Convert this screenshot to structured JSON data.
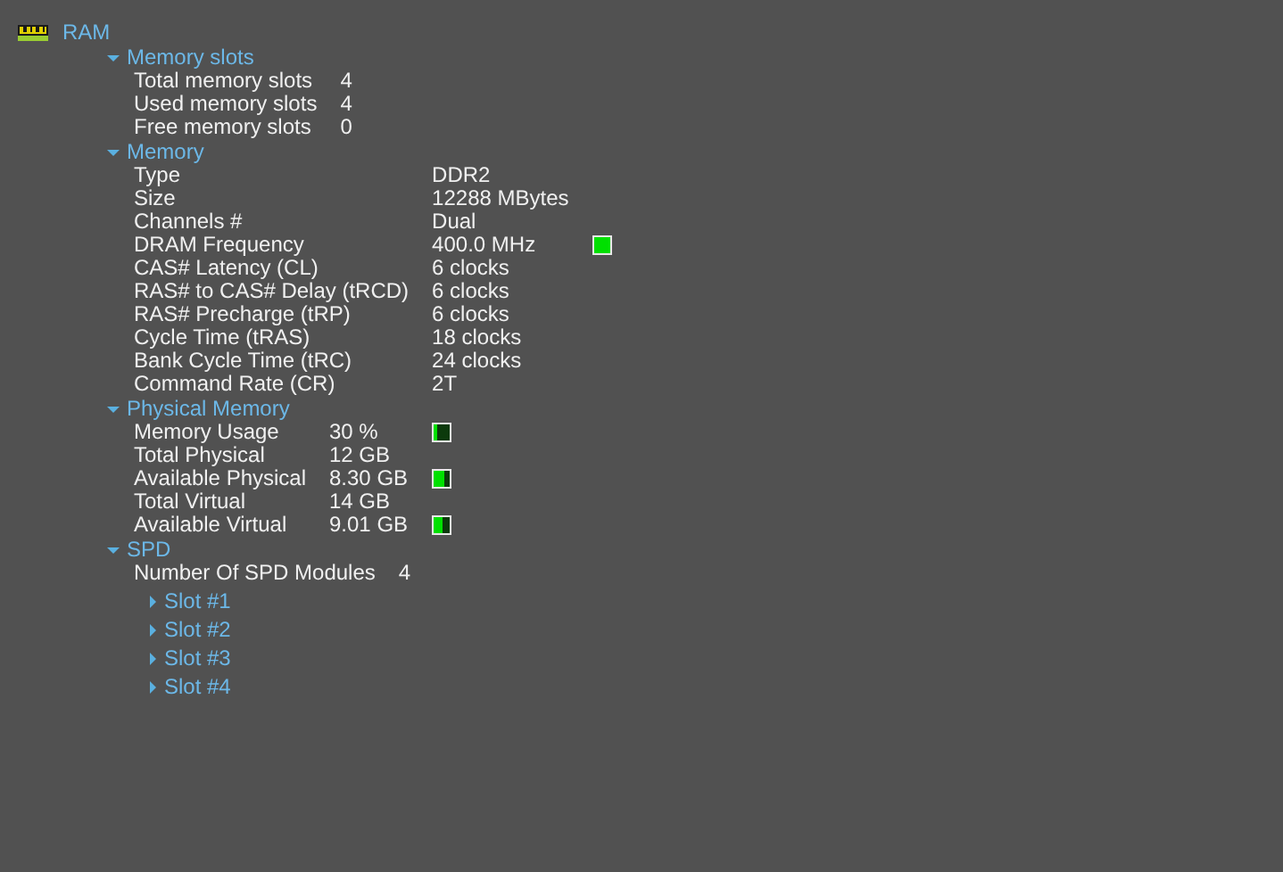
{
  "tree": {
    "label": "RAM",
    "sections": [
      {
        "label": "Memory slots",
        "expanded": true,
        "rows": [
          {
            "name": "Total memory slots",
            "value": "4"
          },
          {
            "name": "Used memory slots",
            "value": "4"
          },
          {
            "name": "Free memory slots",
            "value": "0"
          }
        ]
      },
      {
        "label": "Memory",
        "expanded": true,
        "rows": [
          {
            "name": "Type",
            "value": "DDR2"
          },
          {
            "name": "Size",
            "value": "12288 MBytes"
          },
          {
            "name": "Channels #",
            "value": "Dual"
          },
          {
            "name": "DRAM Frequency",
            "value": "400.0 MHz",
            "level": 1
          },
          {
            "name": "CAS# Latency (CL)",
            "value": "6 clocks"
          },
          {
            "name": "RAS# to CAS# Delay (tRCD)",
            "value": "6 clocks"
          },
          {
            "name": "RAS# Precharge (tRP)",
            "value": "6 clocks"
          },
          {
            "name": "Cycle Time (tRAS)",
            "value": "18 clocks"
          },
          {
            "name": "Bank Cycle Time (tRC)",
            "value": "24 clocks"
          },
          {
            "name": "Command Rate (CR)",
            "value": "2T"
          }
        ]
      },
      {
        "label": "Physical Memory",
        "expanded": true,
        "rows": [
          {
            "name": "Memory Usage",
            "value": "30 %",
            "level": 0.3
          },
          {
            "name": "Total Physical",
            "value": "12 GB"
          },
          {
            "name": "Available Physical",
            "value": "8.30 GB",
            "level": 0.7
          },
          {
            "name": "Total Virtual",
            "value": "14 GB"
          },
          {
            "name": "Available Virtual",
            "value": "9.01 GB",
            "level": 0.64
          }
        ]
      },
      {
        "label": "SPD",
        "expanded": true,
        "rows": [
          {
            "name": "Number Of SPD Modules",
            "value": "4"
          }
        ],
        "children": [
          {
            "label": "Slot #1",
            "expanded": false
          },
          {
            "label": "Slot #2",
            "expanded": false
          },
          {
            "label": "Slot #3",
            "expanded": false
          },
          {
            "label": "Slot #4",
            "expanded": false
          }
        ]
      }
    ]
  }
}
